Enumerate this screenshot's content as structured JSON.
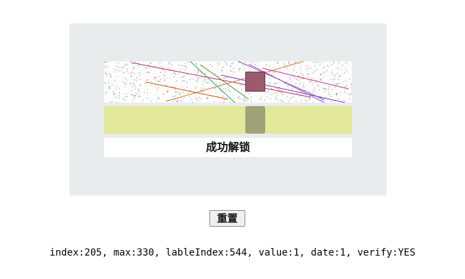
{
  "captcha": {
    "status_text": "成功解锁",
    "piece_color": "#9b5a6e",
    "track_color": "#e2e899",
    "handle_color": "#a0a27b"
  },
  "controls": {
    "reset_label": "重置"
  },
  "debug": {
    "text": "index:205, max:330, lableIndex:544, value:1, date:1, verify:YES"
  }
}
